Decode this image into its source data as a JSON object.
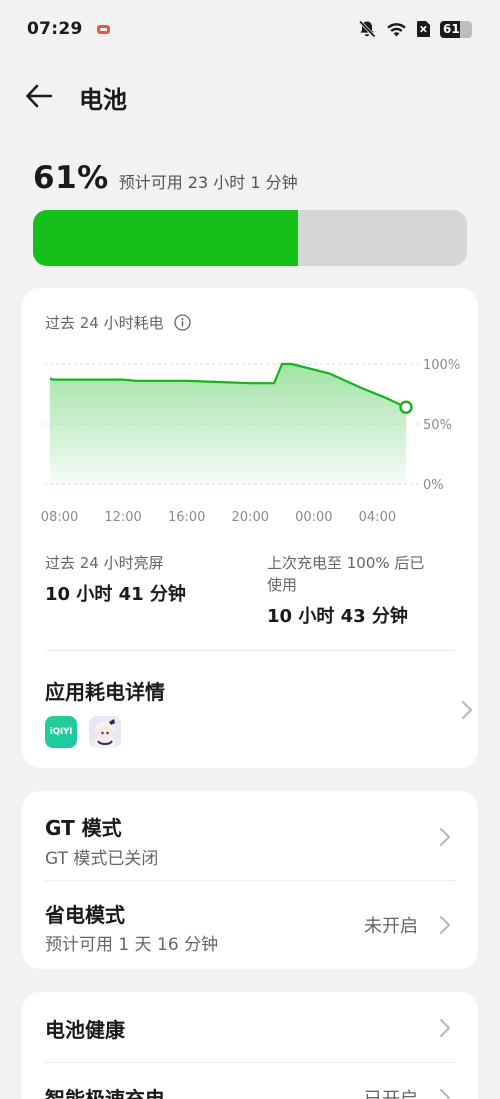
{
  "status_bar": {
    "time": "07:29",
    "battery_level": "61",
    "icons": [
      "game-icon",
      "mute-icon",
      "wifi-icon",
      "no-sim-icon",
      "battery-icon"
    ]
  },
  "nav": {
    "title": "电池",
    "back_icon": "arrow-left-icon"
  },
  "battery": {
    "percent": "61%",
    "estimate": "预计可用 23 小时 1 分钟",
    "level": 61,
    "fill_color": "#16c01a"
  },
  "usage_card": {
    "title": "过去 24 小时耗电",
    "info_icon": "info-icon",
    "screen_on_label": "过去 24 小时亮屏",
    "screen_on_value": "10 小时 41 分钟",
    "since_full_label_line1": "上次充电至 100% 后已",
    "since_full_label_line2": "使用",
    "since_full_value": "10 小时 43 分钟",
    "apps_title": "应用耗电详情",
    "apps": [
      "iQIYI",
      "genshin-impact"
    ],
    "iqiyi_text": "iQIYI"
  },
  "chart_data": {
    "type": "area",
    "x_ticks": [
      "08:00",
      "12:00",
      "16:00",
      "20:00",
      "00:00",
      "04:00"
    ],
    "y_ticks": [
      "100%",
      "50%",
      "0%"
    ],
    "ylim": [
      0,
      100
    ],
    "xlim_hours": [
      7.4,
      29.8
    ],
    "points": [
      {
        "t": 7.4,
        "v": 88
      },
      {
        "t": 7.6,
        "v": 87
      },
      {
        "t": 12.0,
        "v": 87
      },
      {
        "t": 12.8,
        "v": 86
      },
      {
        "t": 16.0,
        "v": 86
      },
      {
        "t": 18.0,
        "v": 85
      },
      {
        "t": 20.0,
        "v": 84
      },
      {
        "t": 21.5,
        "v": 84
      },
      {
        "t": 22.0,
        "v": 100
      },
      {
        "t": 22.6,
        "v": 100
      },
      {
        "t": 25.0,
        "v": 92
      },
      {
        "t": 27.0,
        "v": 80
      },
      {
        "t": 28.5,
        "v": 72
      },
      {
        "t": 29.8,
        "v": 64
      }
    ],
    "line_color": "#16b21a"
  },
  "modes_card": {
    "gt_title": "GT 模式",
    "gt_sub": "GT 模式已关闭",
    "saver_title": "省电模式",
    "saver_sub": "预计可用 1 天 16 分钟",
    "saver_value": "未开启"
  },
  "health_card": {
    "health_title": "电池健康",
    "charge_title": "智能极速充电",
    "charge_value": "已开启"
  }
}
